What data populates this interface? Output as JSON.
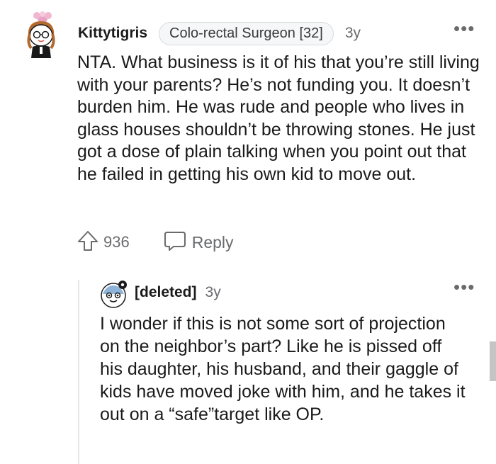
{
  "comment": {
    "username": "Kittytigris",
    "flair": "Colo-rectal Surgeon [32]",
    "age": "3y",
    "body": "NTA. What business is it of his that you’re still living with your parents? He’s not funding you. It doesn’t burden him. He was rude and people who lives in glass houses shouldn’t be throwing stones. He just got a dose of plain talking when you point out that he failed in getting his own kid to move out.",
    "votes": "936",
    "reply_label": "Reply",
    "more": "•••"
  },
  "reply": {
    "username": "[deleted]",
    "age": "3y",
    "body": "I wonder if this is not some sort of projection on the neighbor’s part? Like he is pissed off his daughter, his husband, and their gaggle of kids have moved joke with him, and he takes it out on a “safe”target like OP.",
    "more": "•••"
  },
  "icons": {
    "upvote": "arrow-up-outline-icon",
    "reply": "speech-bubble-icon",
    "more": "horizontal-ellipsis-icon"
  },
  "colors": {
    "text": "#1a1a1b",
    "meta": "#6a6b6d",
    "flair_border": "#d7dadc",
    "thread_line": "#e6e7e8"
  }
}
